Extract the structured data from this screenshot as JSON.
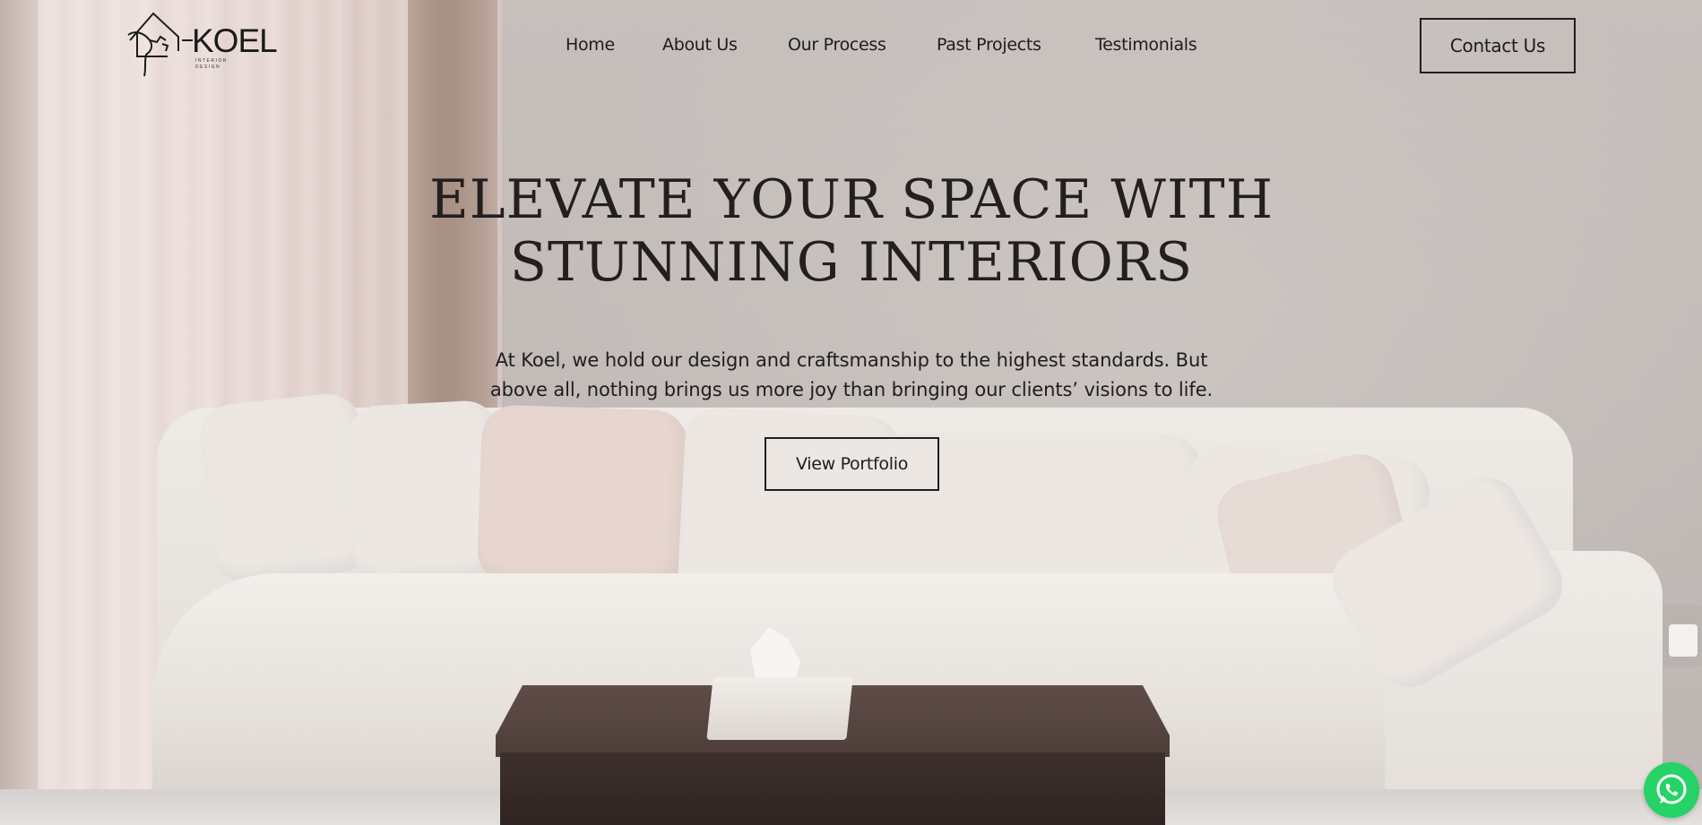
{
  "brand": {
    "name": "KOEL",
    "tagline": "INTERIOR DESIGN",
    "logo_icon": "house-bird-logo-icon"
  },
  "nav": {
    "items": [
      {
        "label": "Home"
      },
      {
        "label": "About Us"
      },
      {
        "label": "Our Process"
      },
      {
        "label": "Past Projects"
      },
      {
        "label": "Testimonials"
      }
    ],
    "cta_label": "Contact Us"
  },
  "hero": {
    "title_line1": "ELEVATE YOUR SPACE WITH",
    "title_line2": "STUNNING INTERIORS",
    "description": "At Koel, we hold our design and craftsmanship to the highest standards. But above all, nothing brings us more joy than bringing our clients’ visions to life.",
    "button_label": "View Portfolio"
  },
  "floating": {
    "whatsapp_icon": "whatsapp-icon",
    "whatsapp_color": "#25d366"
  },
  "colors": {
    "text": "#1f1f1f",
    "button_border": "#1e1e1e"
  }
}
